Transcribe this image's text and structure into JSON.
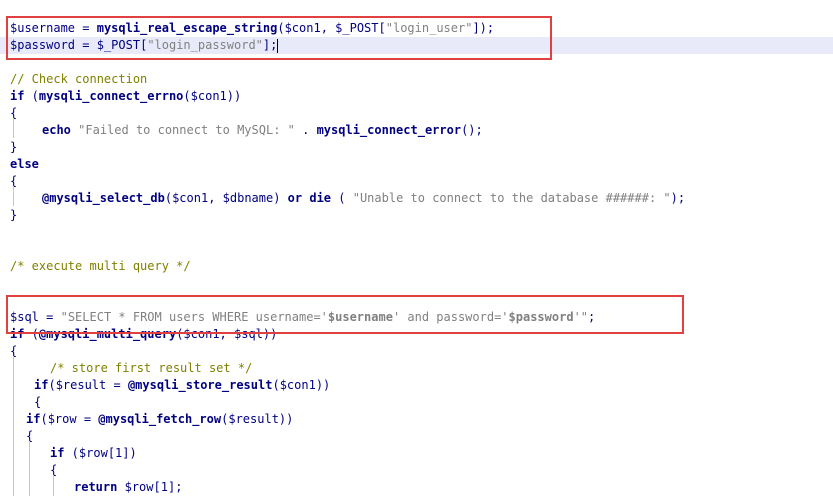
{
  "editor": {
    "cutoff_top_line": "   ...  ...  ...  ...  ...  ...",
    "lines": {
      "username": [
        "$username",
        " = ",
        "mysqli_real_escape_string",
        "(",
        "$con1",
        ", ",
        "$_POST",
        "[",
        "\"login_user\"",
        "]);"
      ],
      "password": [
        "$password",
        " = ",
        "$_POST",
        "[",
        "\"login_password\"",
        "];"
      ],
      "comment_check": "// Check connection",
      "if_errno": [
        "if",
        " (",
        "mysqli_connect_errno",
        "(",
        "$con1",
        "))"
      ],
      "brace_open_1": "{",
      "echo": [
        "echo",
        " ",
        "\"Failed to connect to MySQL: \"",
        " . ",
        "mysqli_connect_error",
        "();"
      ],
      "brace_close_1": "}",
      "else": "else",
      "brace_open_2": "{",
      "select_db": [
        "@mysqli_select_db",
        "(",
        "$con1",
        ", ",
        "$dbname",
        ") ",
        "or",
        " ",
        "die",
        " ( ",
        "\"Unable to connect to the database ######: \"",
        ");"
      ],
      "brace_close_2": "}",
      "comment_multi": "/* execute multi query */",
      "sql": [
        "$sql",
        " = ",
        "\"SELECT * FROM users WHERE username='",
        "$username",
        "' and password='",
        "$password",
        "'\"",
        ";"
      ],
      "if_multi": [
        "if",
        " (",
        "@mysqli_multi_query",
        "(",
        "$con1",
        ", ",
        "$sql",
        "))"
      ],
      "brace_open_3": "{",
      "comment_store": "/* store first result set */",
      "if_result": [
        "if",
        "(",
        "$result",
        " = ",
        "@mysqli_store_result",
        "(",
        "$con1",
        "))"
      ],
      "brace_open_4": "{",
      "if_row": [
        "if",
        "(",
        "$row",
        " = ",
        "@mysqli_fetch_row",
        "(",
        "$result",
        "))"
      ],
      "brace_open_5": "{",
      "if_row1": [
        "if",
        " (",
        "$row",
        "[",
        "1",
        "])"
      ],
      "brace_open_6": "{",
      "return": [
        "return",
        " ",
        "$row",
        "[",
        "1",
        "];"
      ]
    }
  },
  "colors": {
    "highlight_box": "#e0403f",
    "current_line": "#e8eaf9",
    "keyword": "#000080",
    "string": "#808080",
    "comment": "#808000"
  }
}
